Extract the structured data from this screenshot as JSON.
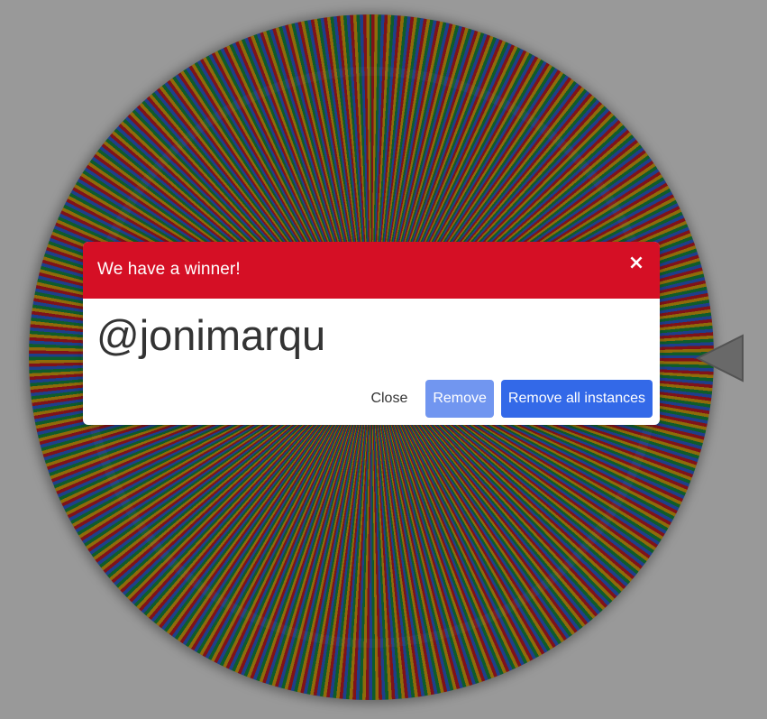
{
  "modal": {
    "title": "We have a winner!",
    "close_icon": "×",
    "winner": "@jonimarqu",
    "buttons": {
      "close": "Close",
      "remove": "Remove",
      "remove_all": "Remove all instances"
    }
  },
  "colors": {
    "header": "#d50f25",
    "primary": "#3369e8",
    "primary_light": "#7196f0",
    "segment_red": "#d61f2a",
    "segment_yellow": "#eeb211",
    "segment_green": "#1a9a47",
    "segment_blue": "#3369e8"
  },
  "icons": {
    "close": "close-icon",
    "pointer": "pointer-triangle-icon"
  }
}
